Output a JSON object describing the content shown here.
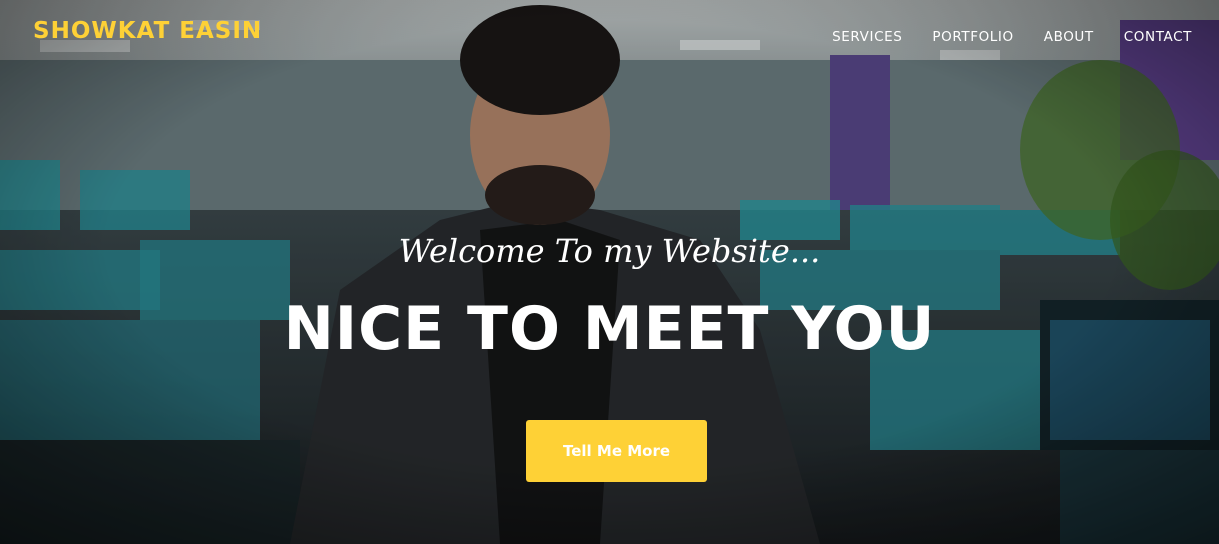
{
  "brand": {
    "name": "SHOWKAT EASIN",
    "color": "#fed136"
  },
  "nav": {
    "items": [
      {
        "label": "SERVICES"
      },
      {
        "label": "PORTFOLIO"
      },
      {
        "label": "ABOUT"
      },
      {
        "label": "CONTACT"
      }
    ]
  },
  "hero": {
    "lead": "Welcome To my Website...",
    "heading": "NICE TO MEET YOU",
    "button_label": "Tell Me More",
    "button_color": "#fed136"
  }
}
